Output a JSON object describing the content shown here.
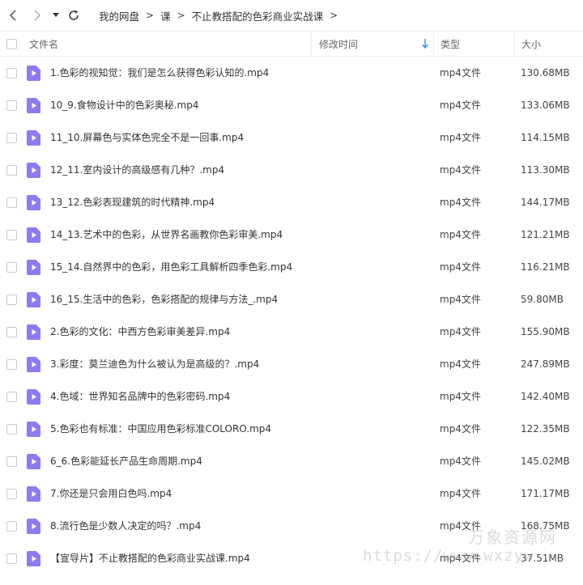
{
  "breadcrumb": {
    "items": [
      "我的网盘",
      "课",
      "不止教搭配的色彩商业实战课"
    ],
    "separator": ">"
  },
  "columns": {
    "name": "文件名",
    "modified": "修改时间",
    "type": "类型",
    "size": "大小"
  },
  "files": [
    {
      "name": "1.色彩的视知觉：我们是怎么获得色彩认知的.mp4",
      "type": "mp4文件",
      "size": "130.68MB"
    },
    {
      "name": "10_9.食物设计中的色彩奥秘.mp4",
      "type": "mp4文件",
      "size": "133.06MB"
    },
    {
      "name": "11_10.屏幕色与实体色完全不是一回事.mp4",
      "type": "mp4文件",
      "size": "114.15MB"
    },
    {
      "name": "12_11.室内设计的高级感有几种？.mp4",
      "type": "mp4文件",
      "size": "113.30MB"
    },
    {
      "name": "13_12.色彩表现建筑的时代精神.mp4",
      "type": "mp4文件",
      "size": "144.17MB"
    },
    {
      "name": "14_13.艺术中的色彩，从世界名画教你色彩审美.mp4",
      "type": "mp4文件",
      "size": "121.21MB"
    },
    {
      "name": "15_14.自然界中的色彩，用色彩工具解析四季色彩.mp4",
      "type": "mp4文件",
      "size": "116.21MB"
    },
    {
      "name": "16_15.生活中的色彩，色彩搭配的规律与方法_.mp4",
      "type": "mp4文件",
      "size": "59.80MB"
    },
    {
      "name": "2.色彩的文化：中西方色彩审美差异.mp4",
      "type": "mp4文件",
      "size": "155.90MB"
    },
    {
      "name": "3.彩度：莫兰迪色为什么被认为是高级的？.mp4",
      "type": "mp4文件",
      "size": "247.89MB"
    },
    {
      "name": "4.色域：世界知名品牌中的色彩密码.mp4",
      "type": "mp4文件",
      "size": "142.40MB"
    },
    {
      "name": "5.色彩也有标准：中国应用色彩标准COLORO.mp4",
      "type": "mp4文件",
      "size": "122.35MB"
    },
    {
      "name": "6_6.色彩能延长产品生命周期.mp4",
      "type": "mp4文件",
      "size": "145.02MB"
    },
    {
      "name": "7.你还是只会用白色吗.mp4",
      "type": "mp4文件",
      "size": "171.17MB"
    },
    {
      "name": "8.流行色是少数人决定的吗？.mp4",
      "type": "mp4文件",
      "size": "168.75MB"
    },
    {
      "name": "【宣导片】不止教搭配的色彩商业实战课.mp4",
      "type": "mp4文件",
      "size": "37.51MB"
    }
  ],
  "watermark": {
    "brand": "万象资源网",
    "url": "https://www.wxzyw"
  },
  "colors": {
    "file_icon": "#8b7cf0",
    "sort_arrow": "#2f8cf5"
  }
}
